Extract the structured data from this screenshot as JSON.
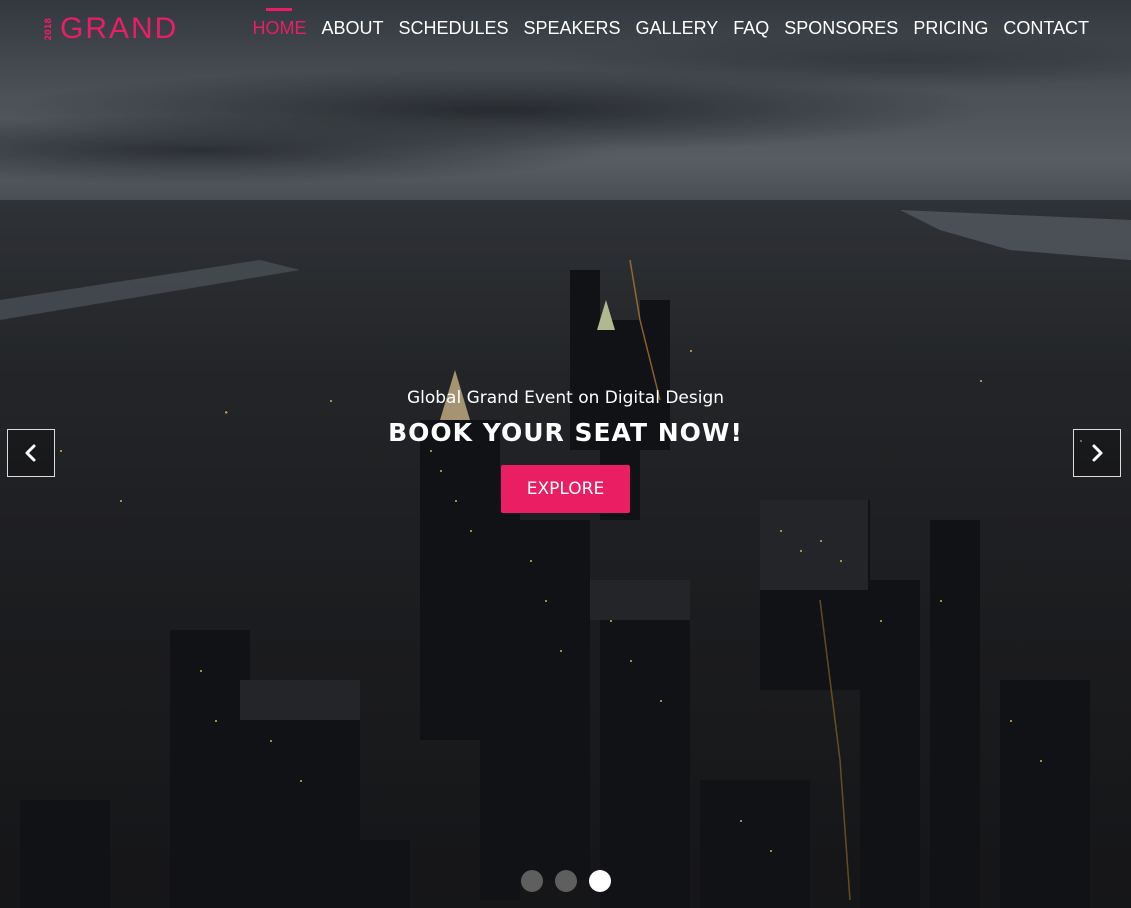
{
  "logo": {
    "year": "2018",
    "name": "GRAND"
  },
  "nav": {
    "items": [
      {
        "label": "HOME",
        "active": true
      },
      {
        "label": "ABOUT",
        "active": false
      },
      {
        "label": "SCHEDULES",
        "active": false
      },
      {
        "label": "SPEAKERS",
        "active": false
      },
      {
        "label": "GALLERY",
        "active": false
      },
      {
        "label": "FAQ",
        "active": false
      },
      {
        "label": "SPONSORES",
        "active": false
      },
      {
        "label": "PRICING",
        "active": false
      },
      {
        "label": "CONTACT",
        "active": false
      }
    ]
  },
  "hero": {
    "subtitle": "Global Grand Event on Digital Design",
    "headline": "BOOK YOUR SEAT NOW!",
    "cta_label": "EXPLORE"
  },
  "carousel": {
    "prev_icon": "chevron-left-icon",
    "next_icon": "chevron-right-icon",
    "slide_count": 3,
    "active_slide": 3
  },
  "colors": {
    "accent": "#e91e63",
    "nav_text": "#ffffff"
  }
}
